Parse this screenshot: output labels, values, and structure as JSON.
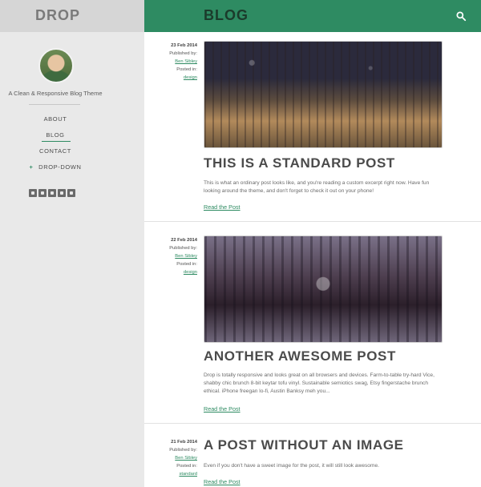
{
  "header": {
    "brand": "DROP",
    "section": "BLOG"
  },
  "sidebar": {
    "tagline": "A Clean & Responsive Blog Theme",
    "nav": [
      {
        "label": "ABOUT"
      },
      {
        "label": "BLOG"
      },
      {
        "label": "CONTACT"
      },
      {
        "label": "DROP-DOWN"
      }
    ],
    "social_icons": [
      "twitter-icon",
      "google-plus-icon",
      "pinterest-icon",
      "tumblr-icon",
      "rss-icon"
    ]
  },
  "posts": [
    {
      "date": "23 Feb 2014",
      "published_by_label": "Published by:",
      "author": "Ben Sibley",
      "posted_in_label": "Posted in:",
      "category": "design",
      "title": "THIS IS A STANDARD POST",
      "excerpt": "This is what an ordinary post looks like, and you're reading a custom excerpt right now. Have fun looking around the theme, and don't forget to check it out on your phone!",
      "read_label": "Read the Post"
    },
    {
      "date": "22 Feb 2014",
      "published_by_label": "Published by:",
      "author": "Ben Sibley",
      "posted_in_label": "Posted in:",
      "category": "design",
      "title": "ANOTHER AWESOME POST",
      "excerpt": "Drop is totally responsive and looks great on all browsers and devices. Farm-to-table try-hard Vice, shabby chic brunch 8-bit keytar tofu vinyl. Sustainable semiotics swag, Etsy fingerstache brunch ethical. iPhone freegan lo-fi, Austin Banksy meh you...",
      "read_label": "Read the Post"
    },
    {
      "date": "21 Feb 2014",
      "published_by_label": "Published by:",
      "author": "Ben Sibley",
      "posted_in_label": "Posted in:",
      "category": "standard",
      "title": "A POST WITHOUT AN IMAGE",
      "excerpt": "Even if you don't have a sweet image for the post, it will still look awesome.",
      "read_label": "Read the Post"
    }
  ]
}
